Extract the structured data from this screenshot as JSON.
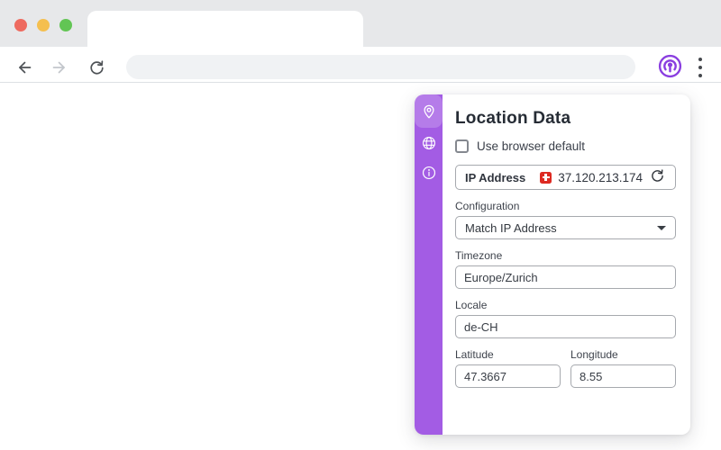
{
  "colors": {
    "chrome_bg": "#e7e8ea",
    "accent_sidebar": "#a35ce4",
    "accent_icon": "#8a3ee0",
    "flag_red": "#dd2a22",
    "light_close": "#ee6a5f",
    "light_minimize": "#f5bf4f",
    "light_maximize": "#62c554"
  },
  "window": {
    "traffic_lights": [
      {
        "name": "close"
      },
      {
        "name": "minimize"
      },
      {
        "name": "maximize"
      }
    ]
  },
  "toolbar": {
    "address_value": "",
    "address_placeholder": ""
  },
  "popup": {
    "title": "Location Data",
    "use_browser_default": {
      "label": "Use browser default",
      "checked": false
    },
    "ip": {
      "label": "IP Address",
      "value": "37.120.213.174",
      "country_flag": "CH"
    },
    "configuration": {
      "label": "Configuration",
      "value": "Match IP Address"
    },
    "timezone": {
      "label": "Timezone",
      "value": "Europe/Zurich"
    },
    "locale": {
      "label": "Locale",
      "value": "de-CH"
    },
    "latitude": {
      "label": "Latitude",
      "value": "47.3667"
    },
    "longitude": {
      "label": "Longitude",
      "value": "8.55"
    },
    "sidebar": {
      "items": [
        {
          "icon": "location-pin",
          "active": true
        },
        {
          "icon": "globe",
          "active": false
        },
        {
          "icon": "info",
          "active": false
        }
      ]
    }
  }
}
